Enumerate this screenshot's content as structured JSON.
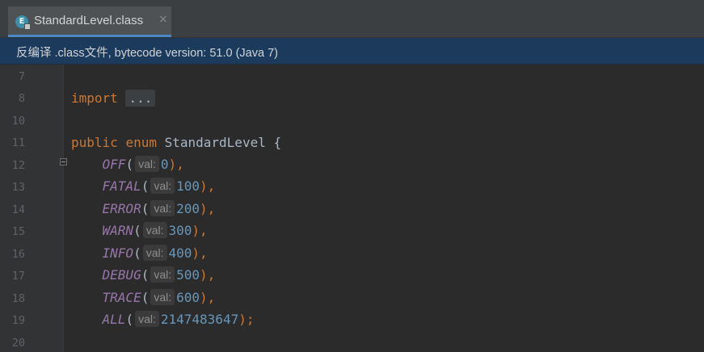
{
  "window": {
    "top_fragment": ""
  },
  "tab": {
    "title": "StandardLevel.class",
    "icon": "enum-class-icon",
    "icon_letter": "E",
    "close_glyph": "×"
  },
  "banner": {
    "text": "反编译 .class文件, bytecode version: 51.0 (Java 7)"
  },
  "gutter": {
    "line_numbers": [
      "7",
      "8",
      "10",
      "11",
      "12",
      "13",
      "14",
      "15",
      "16",
      "17",
      "18",
      "19",
      "20"
    ]
  },
  "code": {
    "import_keyword": "import",
    "import_folded": "...",
    "enum_decl": {
      "mod": "public",
      "kw": "enum",
      "name": "StandardLevel",
      "brace": "{"
    },
    "hint_label": "val:",
    "constants": [
      {
        "name": "OFF",
        "value": "0",
        "end": "),"
      },
      {
        "name": "FATAL",
        "value": "100",
        "end": "),"
      },
      {
        "name": "ERROR",
        "value": "200",
        "end": "),"
      },
      {
        "name": "WARN",
        "value": "300",
        "end": "),"
      },
      {
        "name": "INFO",
        "value": "400",
        "end": "),"
      },
      {
        "name": "DEBUG",
        "value": "500",
        "end": "),"
      },
      {
        "name": "TRACE",
        "value": "600",
        "end": "),"
      },
      {
        "name": "ALL",
        "value": "2147483647",
        "end": ");"
      }
    ]
  },
  "colors": {
    "keyword": "#cc7832",
    "enum_constant": "#9876aa",
    "number": "#6897bb",
    "text": "#a9b7c6",
    "banner_bg": "#1c3b5c",
    "editor_bg": "#2b2b2b"
  }
}
